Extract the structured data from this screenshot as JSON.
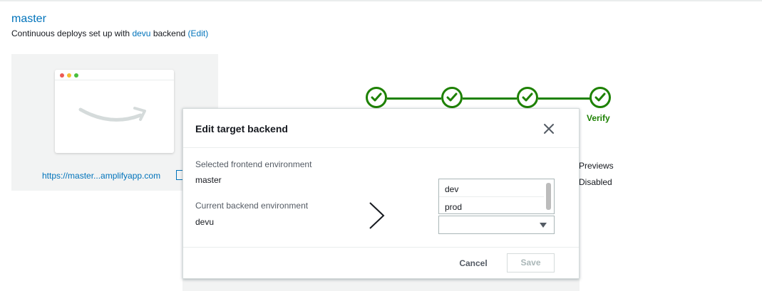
{
  "branch": {
    "name": "master",
    "subtitle_prefix": "Continuous deploys set up with",
    "backend_link": "devu",
    "subtitle_suffix": "backend",
    "edit_link": "(Edit)"
  },
  "preview": {
    "url": "https://master...amplifyapp.com"
  },
  "pipeline": {
    "steps_completed": 4,
    "last_step_label": "Verify",
    "status_color": "#1d8102"
  },
  "details": {
    "previews_label": "Previews",
    "previews_value": "Disabled"
  },
  "modal": {
    "title": "Edit target backend",
    "close_icon": "close-icon",
    "frontend_label": "Selected frontend environment",
    "frontend_value": "master",
    "backend_label": "Current backend environment",
    "backend_value": "devu",
    "options": [
      "dev",
      "prod"
    ],
    "selected_value": "",
    "cancel_label": "Cancel",
    "save_label": "Save"
  },
  "colors": {
    "link": "#0073bb",
    "success": "#1d8102",
    "text": "#16191f",
    "muted": "#545b64"
  }
}
